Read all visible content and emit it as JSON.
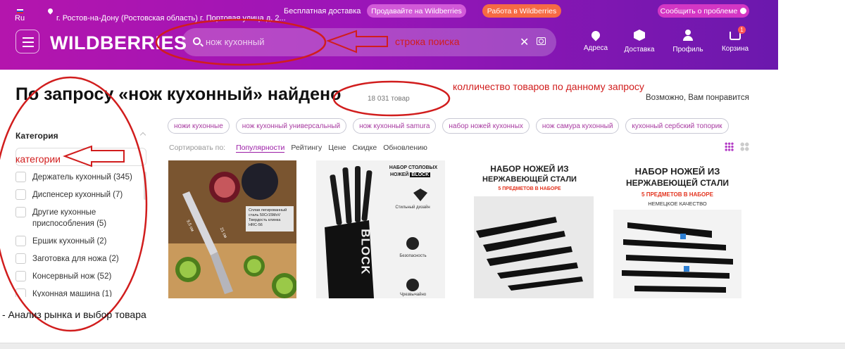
{
  "topbar": {
    "lang": "Ru",
    "location": "г. Ростов-на-Дону (Ростовская область) г. Портовая улица д. 2...",
    "free_delivery": "Бесплатная доставка",
    "sell_button": "Продавайте на Wildberries",
    "work_button": "Работа в Wildberries",
    "report_button": "Сообщить о проблеме"
  },
  "header": {
    "logo": "WILDBERRIES",
    "search_placeholder": "нож кухонный",
    "nav": {
      "addresses": "Адреса",
      "delivery": "Доставка",
      "profile": "Профиль",
      "cart": "Корзина",
      "cart_count": "1"
    }
  },
  "results": {
    "title": "По запросу «нож кухонный» найдено",
    "count": "18 031 товар",
    "maybe_like": "Возможно, Вам понравится"
  },
  "tags": [
    "ножи кухонные",
    "нож кухонный универсальный",
    "нож кухонный samura",
    "набор ножей кухонных",
    "нож самура кухонный",
    "кухонный сербский топорик"
  ],
  "sort": {
    "label": "Сортировать по:",
    "options": [
      "Популярности",
      "Рейтингу",
      "Цене",
      "Скидке",
      "Обновлению"
    ],
    "active": "Популярности"
  },
  "sidebar": {
    "title": "Категория",
    "items": [
      "Держатель кухонный (345)",
      "Диспенсер кухонный (7)",
      "Другие кухонные приспособления (5)",
      "Ершик кухонный (2)",
      "Заготовка для ножа (2)",
      "Консервный нож (52)",
      "Кухонная машина (1)"
    ]
  },
  "products": {
    "p1": {
      "label_lines": [
        "Сплав легированный",
        "сталь 50Cr15MoV",
        "Твердость клинка",
        "HRC-56"
      ],
      "dim1": "9,5 см",
      "dim2": "21 см"
    },
    "p2": {
      "header_line1": "НАБОР СТОЛОВЫХ",
      "header_line2": "НОЖЕЙ",
      "brand": "BLOCK",
      "feature1": "Стильный дизайн",
      "feature2": "Безопасность",
      "feature3": "Чрезвычайно"
    },
    "p3": {
      "line1": "НАБОР НОЖЕЙ ИЗ",
      "line2": "НЕРЖАВЕЮЩЕЙ СТАЛИ",
      "banner": "5 ПРЕДМЕТОВ В НАБОРЕ"
    },
    "p4": {
      "line1": "НАБОР НОЖЕЙ ИЗ",
      "line2": "НЕРЖАВЕЮЩЕЙ СТАЛИ",
      "banner": "5 ПРЕДМЕТОВ В НАБОРЕ",
      "sub": "НЕМЕЦКОЕ КАЧЕСТВО"
    }
  },
  "annotations": {
    "search_label": "строка поиска",
    "count_label": "колличество товаров по данному запросу",
    "category_label": "категории",
    "caption": "- Анализ рынка и выбор товара"
  },
  "colors": {
    "header_start": "#b415ad",
    "header_end": "#6b18ad",
    "annotation": "#d11d1d",
    "accent": "#9b1ca6"
  }
}
